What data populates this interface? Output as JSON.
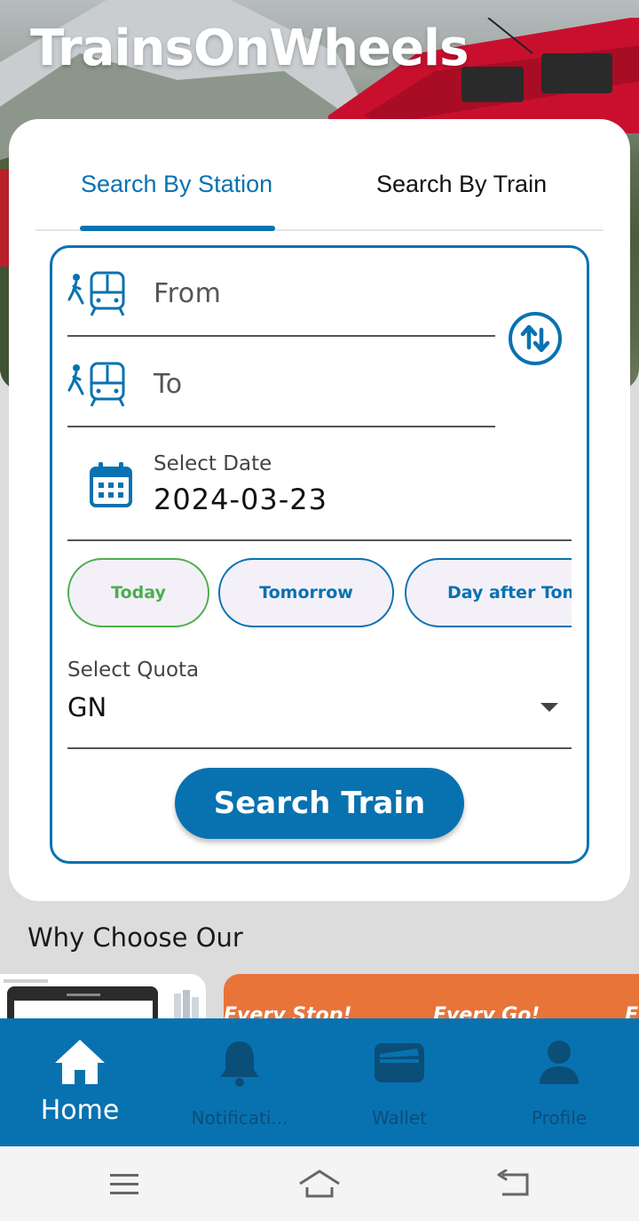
{
  "app": {
    "title": "TrainsOnWheels"
  },
  "tabs": [
    {
      "label": "Search By Station",
      "active": true
    },
    {
      "label": "Search By Train",
      "active": false
    }
  ],
  "form": {
    "from_placeholder": "From",
    "to_placeholder": "To",
    "date_label": "Select Date",
    "date_value": "2024-03-23",
    "quick_dates": [
      "Today",
      "Tomorrow",
      "Day after Tomorrow"
    ],
    "quota_label": "Select Quota",
    "quota_value": "GN",
    "search_button": "Search Train"
  },
  "section": {
    "why_title": "Why Choose Our"
  },
  "promo": {
    "banner_texts": [
      "Every Stop!",
      "Every Go!",
      "E"
    ]
  },
  "bottom_nav": [
    {
      "label": "Home",
      "icon": "home-icon",
      "active": true
    },
    {
      "label": "Notificati...",
      "icon": "bell-icon",
      "active": false
    },
    {
      "label": "Wallet",
      "icon": "wallet-icon",
      "active": false
    },
    {
      "label": "Profile",
      "icon": "person-icon",
      "active": false
    }
  ],
  "colors": {
    "primary": "#0872b0",
    "today_green": "#4caf50",
    "promo_orange": "#e8743a"
  }
}
